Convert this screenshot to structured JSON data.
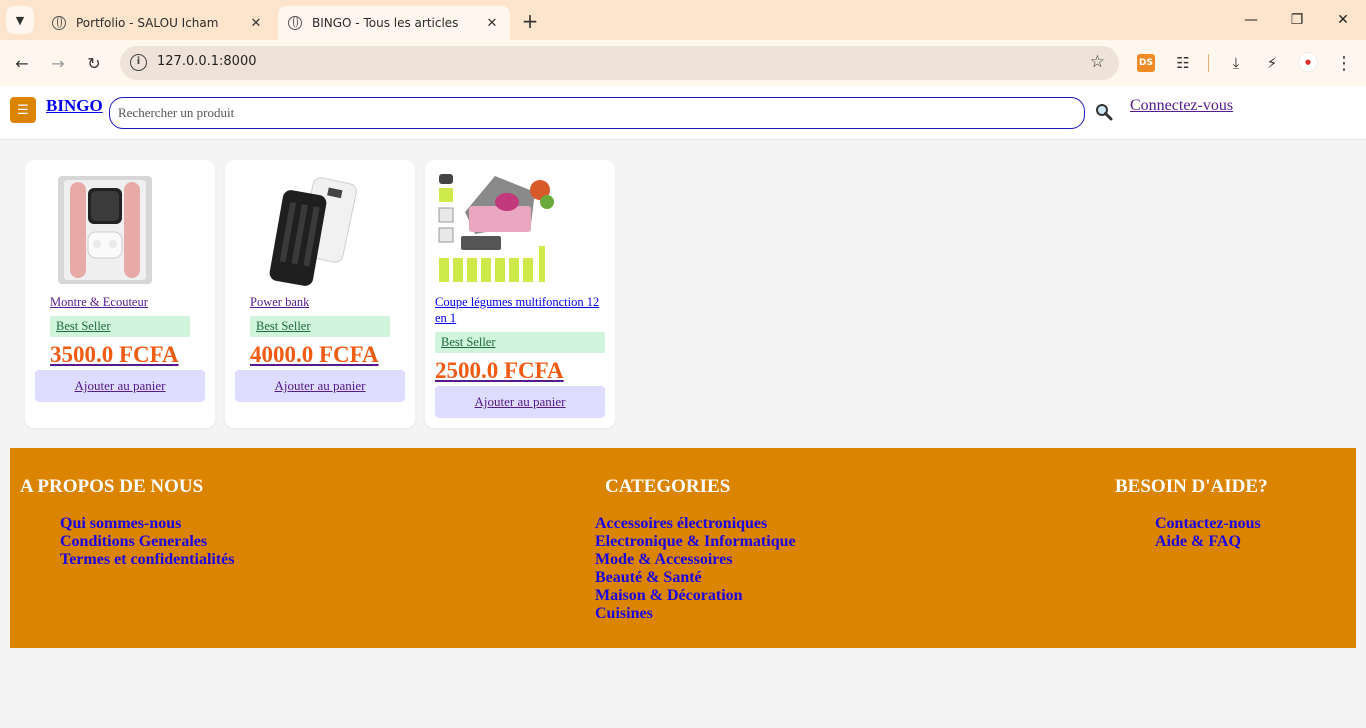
{
  "browser": {
    "tabs": [
      {
        "title": "Portfolio - SALOU Icham",
        "active": false
      },
      {
        "title": "BINGO - Tous les articles",
        "active": true
      }
    ],
    "url": "127.0.0.1:8000",
    "extension_ds_label": "DS"
  },
  "header": {
    "brand": "BINGO",
    "search_placeholder": "Rechercher un produit",
    "login_label": "Connectez-vous"
  },
  "products": [
    {
      "name": "Montre & Ecouteur",
      "badge": "Best Seller",
      "price": "3500.0 FCFA",
      "cart_label": "Ajouter au panier"
    },
    {
      "name": "Power bank",
      "badge": "Best Seller",
      "price": "4000.0 FCFA",
      "cart_label": "Ajouter au panier"
    },
    {
      "name": "Coupe légumes multifonction 12 en 1",
      "badge": "Best Seller",
      "price": "2500.0 FCFA",
      "cart_label": "Ajouter au panier"
    }
  ],
  "footer": {
    "about": {
      "title": "A PROPOS DE NOUS",
      "links": [
        "Qui sommes-nous",
        "Conditions Generales",
        "Termes et confidentialités"
      ]
    },
    "categories": {
      "title": "CATEGORIES",
      "links": [
        "Accessoires électroniques",
        "Electronique & Informatique",
        "Mode & Accessoires",
        "Beauté & Santé",
        "Maison & Décoration",
        "Cuisines"
      ]
    },
    "help": {
      "title": "BESOIN D'AIDE?",
      "links": [
        "Contactez-nous",
        "Aide & FAQ"
      ]
    }
  },
  "colors": {
    "accent": "#db8400",
    "price": "#f15a12",
    "badge_bg": "#d1f5dc",
    "cart_bg": "#dedcff",
    "footer_link": "#1c00e0"
  }
}
